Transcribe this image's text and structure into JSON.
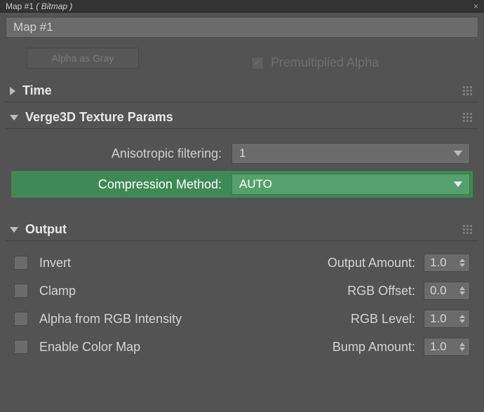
{
  "titlebar": {
    "prefix": "Map #1",
    "suffix": "( Bitmap )"
  },
  "name_field": {
    "value": "Map #1"
  },
  "cutoff": {
    "alpha_as_gray": "Alpha as Gray",
    "premultiplied_alpha": "Premultiplied Alpha"
  },
  "sections": {
    "time": {
      "title": "Time",
      "expanded": false
    },
    "verge3d": {
      "title": "Verge3D Texture Params",
      "expanded": true,
      "anisotropic": {
        "label": "Anisotropic filtering:",
        "value": "1"
      },
      "compression": {
        "label": "Compression Method:",
        "value": "AUTO"
      }
    },
    "output": {
      "title": "Output",
      "expanded": true,
      "rows": [
        {
          "check_label": "Invert",
          "checked": false,
          "spin_label": "Output Amount:",
          "spin_value": "1.0"
        },
        {
          "check_label": "Clamp",
          "checked": false,
          "spin_label": "RGB Offset:",
          "spin_value": "0.0"
        },
        {
          "check_label": "Alpha from RGB Intensity",
          "checked": false,
          "spin_label": "RGB Level:",
          "spin_value": "1.0"
        },
        {
          "check_label": "Enable Color Map",
          "checked": false,
          "spin_label": "Bump Amount:",
          "spin_value": "1.0"
        }
      ]
    }
  },
  "colors": {
    "highlight": "#3e8a55",
    "panel": "#535353",
    "field": "#6b6b6b"
  }
}
